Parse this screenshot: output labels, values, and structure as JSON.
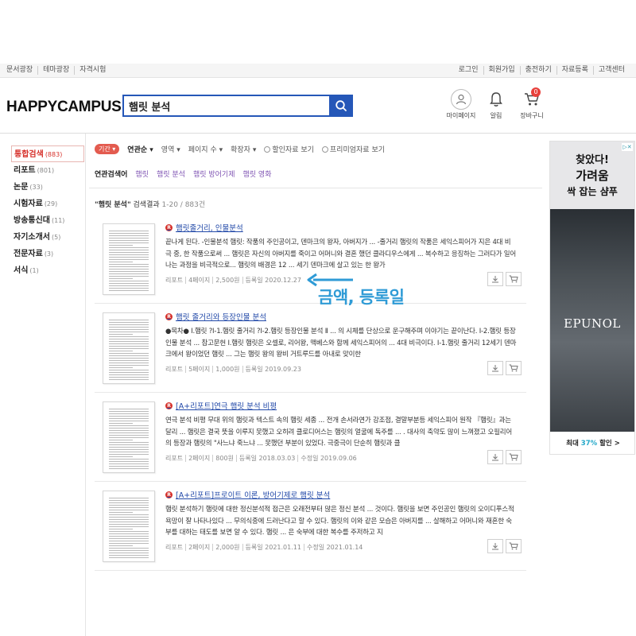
{
  "topnav": {
    "left": [
      "문서광장",
      "테마광장",
      "자격시험"
    ],
    "right": [
      "로그인",
      "회원가입",
      "충전하기",
      "자료등록",
      "고객센터"
    ]
  },
  "header": {
    "logo_main": "HAPPYCAMPUS",
    "logo_mark": "!",
    "search_value": "햄릿 분석",
    "icons": [
      {
        "name": "mypage",
        "label": "마이페이지",
        "icon": "user-icon"
      },
      {
        "name": "alarm",
        "label": "알림",
        "icon": "bell-icon"
      },
      {
        "name": "cart",
        "label": "장바구니",
        "icon": "cart-icon",
        "badge": "0"
      }
    ]
  },
  "sidebar": [
    {
      "label": "통합검색",
      "count": "(883)",
      "active": true
    },
    {
      "label": "리포트",
      "count": "(801)"
    },
    {
      "label": "논문",
      "count": "(33)"
    },
    {
      "label": "시험자료",
      "count": "(29)"
    },
    {
      "label": "방송통신대",
      "count": "(11)"
    },
    {
      "label": "자기소개서",
      "count": "(5)"
    },
    {
      "label": "전문자료",
      "count": "(3)"
    },
    {
      "label": "서식",
      "count": "(1)"
    }
  ],
  "filters": {
    "period": "기간",
    "items": [
      "연관순",
      "영역",
      "페이지 수",
      "확장자"
    ],
    "checks": [
      "할인자료 보기",
      "프리미엄자료 보기"
    ]
  },
  "related": {
    "label": "연관검색어",
    "words": [
      "햄릿",
      "햄릿 분석",
      "햄릿 방어기제",
      "햄릿 영화"
    ]
  },
  "result_head": {
    "query": "\"햄릿 분석\"",
    "suffix": "검색결과",
    "range": "1-20 / 883건"
  },
  "items": [
    {
      "title": "햄릿줄거리, 인물분석",
      "desc": "끝나게 된다. -인물분석 햄릿: 작품의 주인공이고, 덴마크의 왕자, 아버지가 ... -줄거리 햄릿의 작품은 세익스피어가 지은 4대 비극 중, 한 작품으로써 ... 햄릿은 자신의 아버지를 죽이고 어머니와 결혼 했던 클라디우스에게 ... 복수하고 응징하는 그러다가 일어나는 과정을 비극적으로... 햄릿의 배경은 12 ... 세기 덴마크에 살고 있는 한 왕가",
      "meta": [
        "리포트",
        "4페이지",
        "2,500원",
        "등록일 2020.12.27"
      ]
    },
    {
      "title": "햄릿 줄거리와 등장인물 분석",
      "desc": "●목차● Ⅰ.햄릿 ?Ⅰ-1.햄릿 줄거리 ?Ⅰ-2.햄릿 등장인물 분석 Ⅱ ... 의 시체를 단상으로 운구해주며 이야기는 끝이난다. Ⅰ-2.햄릿 등장인물 분석 ... 참고문헌 Ⅰ.햄릿 햄릿은 오셀로, 리어왕, 맥베스와 함께 세익스피어의 ... 4대 비극이다. Ⅰ-1.햄릿 줄거리 12세기 덴마크에서 왕이었던 햄릿 ... 그는 햄릿 왕의 왕비 거트루드를 아내로 맞이한",
      "meta": [
        "리포트",
        "5페이지",
        "1,000원",
        "등록일 2019.09.23"
      ]
    },
    {
      "title": "[A+리포트]연극 햄릿 분석 비평",
      "desc": "연극 분석 비평 무대 위의 햄릿과 텍스트 속의 햄릿 세종 ... 전개 손서라연가 강조점, 결말부분등 세익스피어 원작 『햄릿』과는 달리 ... 햄릿은 결국 뜻을 이루지 못했고 오히려 클로디어스는 햄릿의 얼굴에 독주를 ... . 대사의 축약도 많이 느껴졌고 오필리어의 등장과 햄릿의 \"사느냐 죽느냐 ... 못했던 부분이 있었다. 극중극이 단순히 햄릿과 클",
      "meta": [
        "리포트",
        "2페이지",
        "800원",
        "등록일 2018.03.03",
        "수정일 2019.09.06"
      ]
    },
    {
      "title": "[A+리포트]프로이트 이론, 방어기제로 햄릿 분석",
      "desc": "햄릿 분석하기 햄릿에 대한 정신분석적 접근은 오래전부터 많은 정신 분석 ... 것이다. 햄릿을 보면 주인공인 햄릿의 오이디푸스적 욕망이 잘 나타나있다 ... 무의식중에 드러난다고 할 수 있다. 햄릿의 이와 같은 모습은 아버지를 ... 살해하고 어머니와 재혼한 숙부를 대하는 태도를 보면 알 수 있다. 햄릿 ... 은 숙부에 대한 복수를 주저하고 지",
      "meta": [
        "리포트",
        "2페이지",
        "2,000원",
        "등록일 2021.01.11",
        "수정일 2021.01.14"
      ]
    }
  ],
  "annotation": "금액, 등록일",
  "ad": {
    "line1": "찾았다!",
    "line2": "가려움",
    "line3": "싹 잡는 샴푸",
    "brand": "EPUNOL",
    "bottom_pre": "최대 ",
    "bottom_pct": "37%",
    "bottom_post": " 할인 >"
  }
}
